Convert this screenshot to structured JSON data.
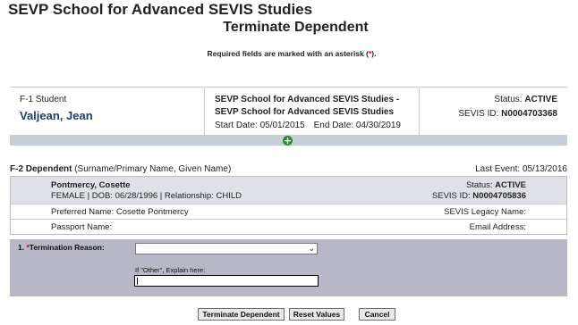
{
  "header": {
    "school_title": "SEVP School for Advanced SEVIS Studies",
    "page_title": "Terminate Dependent",
    "required_note_pre": "Required fields are marked with an asterisk (",
    "required_note_ast": "*",
    "required_note_post": ")."
  },
  "student": {
    "type": "F-1 Student",
    "name": "Valjean, Jean",
    "school_line1": "SEVP School for Advanced SEVIS Studies -",
    "school_line2": "SEVP School for Advanced SEVIS Studies",
    "start_label": "Start Date: ",
    "start_date": "05/01/2015",
    "end_label": "End Date: ",
    "end_date": "04/30/2019",
    "status_label": "Status: ",
    "status_value": "ACTIVE",
    "sevis_label": "SEVIS ID: ",
    "sevis_id": "N0004703368"
  },
  "dependent_header": {
    "label": "F-2 Dependent",
    "sublabel": " (Surname/Primary Name, Given Name)",
    "last_event_label": "Last Event: ",
    "last_event_date": "05/13/2016"
  },
  "dependent": {
    "name": "Pontmercy, Cosette",
    "info": "FEMALE | DOB: 06/28/1996 | Relationship: CHILD",
    "status_label": "Status: ",
    "status_value": "ACTIVE",
    "sevis_label": "SEVIS ID: ",
    "sevis_id": "N0004705836",
    "preferred_name": "Preferred Name: Cosette Pontmercy",
    "legacy_name_label": "SEVIS Legacy Name:",
    "passport_label": "Passport Name:",
    "email_label": "Email Address:"
  },
  "form": {
    "reason_prefix": "1. ",
    "reason_ast": "*",
    "reason_label": "Termination Reason:",
    "reason_selected": "",
    "other_label": "If \"Other\", Explain here:",
    "other_value": ""
  },
  "buttons": {
    "terminate": "Terminate Dependent",
    "reset": "Reset Values",
    "cancel": "Cancel"
  },
  "icons": {
    "expand": "plus-circle-icon",
    "select_arrow": "chevron-down-icon"
  },
  "colors": {
    "name_blue": "#1f3f6b",
    "expand_green": "#2f8a2f",
    "required_red": "#cc0000",
    "form_bg": "#b8b7c7"
  }
}
